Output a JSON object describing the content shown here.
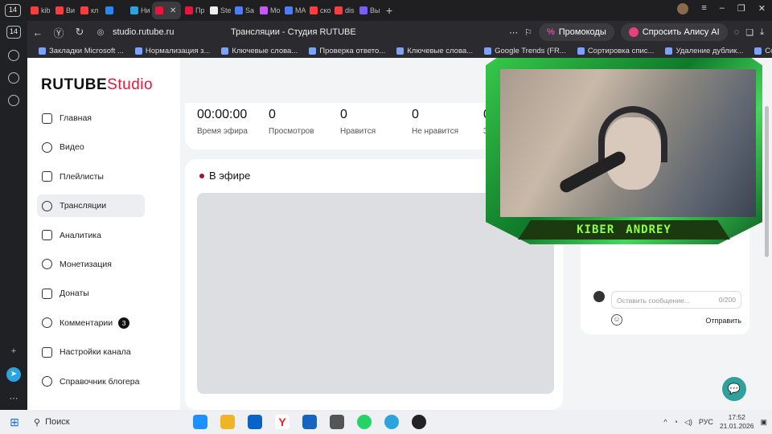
{
  "browser": {
    "tab_count": "14",
    "tabs": [
      {
        "title": "kib",
        "color": "#ff3c3c"
      },
      {
        "title": "Ви",
        "color": "#ff3c3c"
      },
      {
        "title": "кл",
        "color": "#ff3c3c"
      },
      {
        "title": "",
        "color": "#2787f5"
      },
      {
        "title": "Ни",
        "color": "#2aa3df"
      },
      {
        "title": "",
        "color": "#ed143b",
        "active": true
      },
      {
        "title": "Пр",
        "color": "#ed143b"
      },
      {
        "title": "Ste",
        "color": "#eeeeee"
      },
      {
        "title": "Sa",
        "color": "#4d7cff"
      },
      {
        "title": "Mo",
        "color": "#c657ff"
      },
      {
        "title": "MA",
        "color": "#4d7cff"
      },
      {
        "title": "ско",
        "color": "#ff3c3c"
      },
      {
        "title": "dis",
        "color": "#ff3c3c"
      },
      {
        "title": "Вы",
        "color": "#7a5cff"
      }
    ],
    "url": "studio.rutube.ru",
    "page_title": "Трансляции - Студия RUTUBE",
    "promo_label": "Промокоды",
    "alice_label": "Спросить Алису AI",
    "bookmarks": [
      "Закладки Microsoft ...",
      "Нормализация з...",
      "Ключевые слова...",
      "Проверка ответо...",
      "Ключевые слова...",
      "Google Trends (FR...",
      "Сортировка спис...",
      "Удаление дублик...",
      "Сортировка спис..."
    ]
  },
  "rail": {
    "badge": "14"
  },
  "studio": {
    "logo_main": "RUTUBE",
    "logo_accent": "Studio",
    "accent_color": "#ed143b",
    "nav": [
      {
        "label": "Главная",
        "icon": "home-icon"
      },
      {
        "label": "Видео",
        "icon": "video-icon"
      },
      {
        "label": "Плейлисты",
        "icon": "playlist-icon"
      },
      {
        "label": "Трансляции",
        "icon": "broadcast-icon",
        "active": true
      },
      {
        "label": "Аналитика",
        "icon": "analytics-icon"
      },
      {
        "label": "Монетизация",
        "icon": "ruble-icon"
      },
      {
        "label": "Донаты",
        "icon": "wallet-icon"
      },
      {
        "label": "Комментарии",
        "icon": "comment-icon",
        "badge": "3"
      },
      {
        "label": "Настройки канала",
        "icon": "gear-icon"
      },
      {
        "label": "Справочник блогера",
        "icon": "info-icon"
      }
    ],
    "stats": [
      {
        "value": "00:00:00",
        "label": "Время эфира"
      },
      {
        "value": "0",
        "label": "Просмотров"
      },
      {
        "value": "0",
        "label": "Нравится"
      },
      {
        "value": "0",
        "label": "Не нравится"
      },
      {
        "value": "0",
        "label": "Зр"
      }
    ],
    "live_title": "В эфире",
    "chat": {
      "placeholder": "Оставить сообщение...",
      "counter": "0/200",
      "send_label": "Отправить"
    }
  },
  "webcam": {
    "name_left": "KIBER",
    "name_right": "ANDREY"
  },
  "taskbar": {
    "search_label": "Поиск",
    "lang": "РУС",
    "time": "17:52",
    "date": "21.01.2026"
  }
}
